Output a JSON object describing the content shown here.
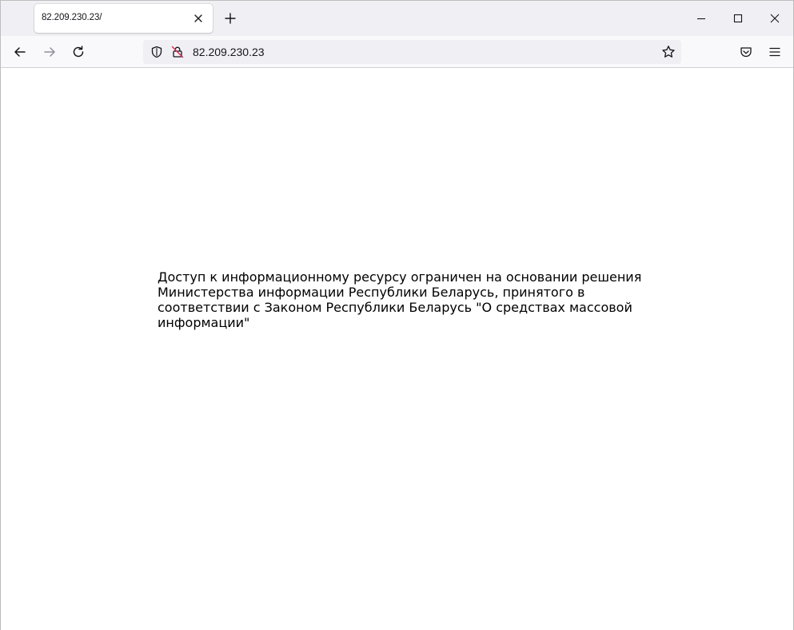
{
  "browser": {
    "tab": {
      "title": "82.209.230.23/"
    },
    "address_bar": {
      "url": "82.209.230.23"
    },
    "icons": {
      "tab_close": "close-icon",
      "new_tab": "plus-icon",
      "minimize": "minimize-icon",
      "maximize": "maximize-icon",
      "window_close": "close-icon",
      "back": "arrow-left-icon",
      "forward": "arrow-right-icon",
      "reload": "reload-icon",
      "tracking_protection": "shield-icon",
      "connection": "insecure-lock-icon",
      "bookmark": "star-icon",
      "pocket": "pocket-icon",
      "menu": "hamburger-menu-icon"
    },
    "colors": {
      "tabstrip_bg": "#f0f0f4",
      "toolbar_bg": "#f9f9fb",
      "urlbar_bg": "#f0f0f4",
      "insecure_red": "#e22850",
      "icon_color": "#15141a"
    }
  },
  "page": {
    "message": "Доступ к информационному ресурсу ограничен на основании решения Министерства информации Республики Беларусь, принятого в соответствии с Законом Республики Беларусь \"О средствах массовой информации\""
  }
}
